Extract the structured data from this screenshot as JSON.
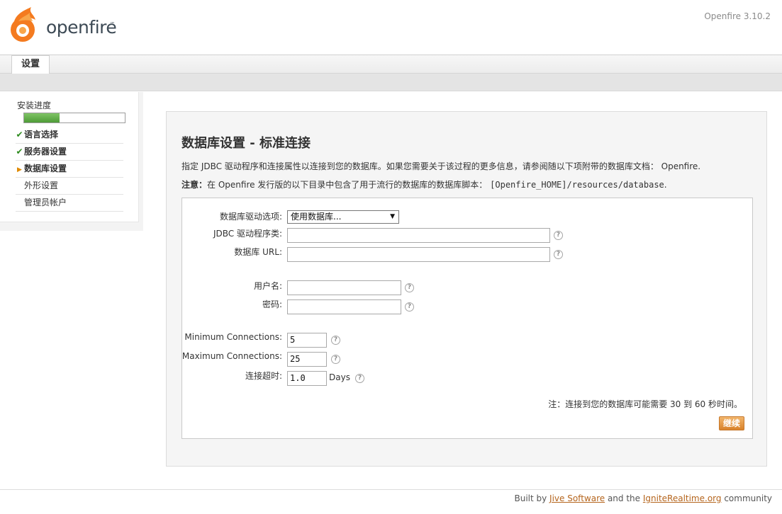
{
  "header": {
    "logo_text": "openfire",
    "logo_tm": "™",
    "version": "Openfire 3.10.2"
  },
  "tabs": [
    {
      "label": "设置"
    }
  ],
  "sidebar": {
    "progress_label": "安装进度",
    "progress_percent": 35,
    "steps": [
      {
        "label": "语言选择",
        "state": "done",
        "mark": "✔"
      },
      {
        "label": "服务器设置",
        "state": "done",
        "mark": "✔"
      },
      {
        "label": "数据库设置",
        "state": "active",
        "mark": "▶"
      },
      {
        "label": "外形设置",
        "state": "pending",
        "mark": ""
      },
      {
        "label": "管理员帐户",
        "state": "pending",
        "mark": ""
      }
    ]
  },
  "main": {
    "title": "数据库设置 - 标准连接",
    "intro": "指定 JDBC 驱动程序和连接属性以连接到您的数据库。如果您需要关于该过程的更多信息，请参阅随以下项附带的数据库文档： Openfire.",
    "note_label": "注意：",
    "note_text": "在 Openfire 发行版的以下目录中包含了用于流行的数据库的数据库脚本：",
    "note_path": "[Openfire_HOME]/resources/database",
    "note_end": "."
  },
  "form": {
    "driver_label": "数据库驱动选项:",
    "driver_selected": "使用数据库...",
    "jdbc_label": "JDBC 驱动程序类:",
    "jdbc_value": "",
    "url_label": "数据库 URL:",
    "url_value": "",
    "username_label": "用户名:",
    "username_value": "",
    "password_label": "密码:",
    "password_value": "",
    "min_label": "Minimum Connections:",
    "min_value": "5",
    "max_label": "Maximum Connections:",
    "max_value": "25",
    "timeout_label": "连接超时:",
    "timeout_value": "1.0",
    "timeout_unit": "Days",
    "help_glyph": "?",
    "note": "注：连接到您的数据库可能需要 30 到 60 秒时间。",
    "continue_label": "继续"
  },
  "footer": {
    "prefix": "Built by ",
    "link1": "Jive Software",
    "mid": " and the ",
    "link2": "IgniteRealtime.org",
    "suffix": " community"
  },
  "colors": {
    "logo_orange": "#f47b20",
    "progress_green": "#5aa845",
    "button_orange": "#e39440",
    "link": "#b5651d"
  },
  "icons": {
    "help": "help-circle-icon",
    "check": "checkmark-icon",
    "current": "arrow-right-icon",
    "dropdown": "chevron-down-icon"
  }
}
